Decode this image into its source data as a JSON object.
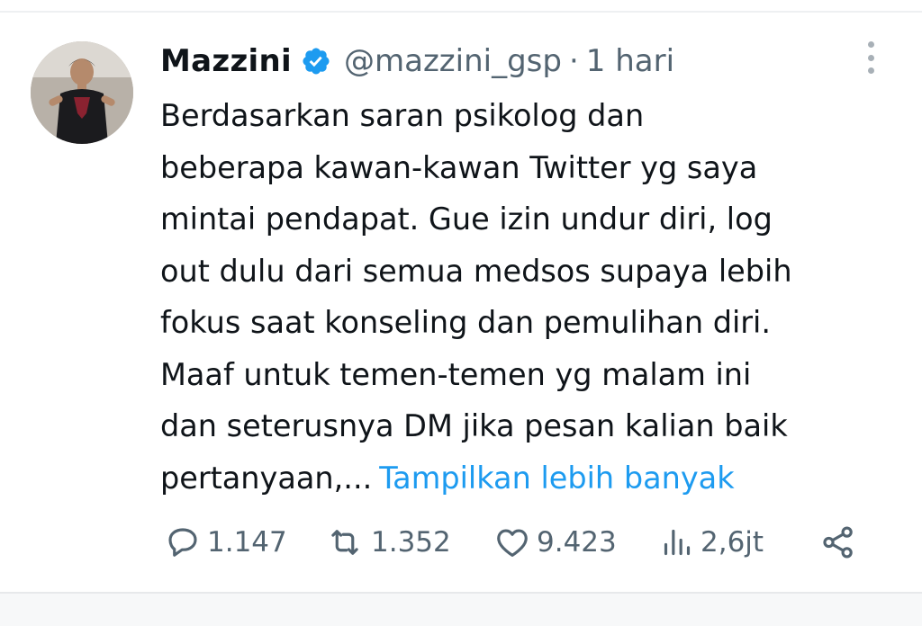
{
  "tweet": {
    "author_name": "Mazzini",
    "handle": "@mazzini_gsp",
    "separator": "·",
    "time": "1 hari",
    "lines": [
      "Berdasarkan saran psikolog dan",
      "beberapa kawan-kawan Twitter yg saya",
      "mintai pendapat. Gue izin undur diri, log",
      "out dulu dari semua medsos supaya lebih",
      "fokus saat konseling dan pemulihan diri.",
      "Maaf untuk temen-temen yg malam ini",
      "dan seterusnya DM jika pesan kalian baik",
      "pertanyaan,..."
    ],
    "show_more": "Tampilkan lebih banyak"
  },
  "actions": {
    "replies": "1.147",
    "retweets": "1.352",
    "likes": "9.423",
    "views": "2,6jt"
  },
  "colors": {
    "link": "#1d9bf0",
    "verified": "#1d9bf0",
    "secondary_text": "#536471"
  },
  "icons": [
    "verified-badge-icon",
    "more-options-icon",
    "reply-icon",
    "retweet-icon",
    "like-icon",
    "views-icon",
    "share-icon"
  ]
}
